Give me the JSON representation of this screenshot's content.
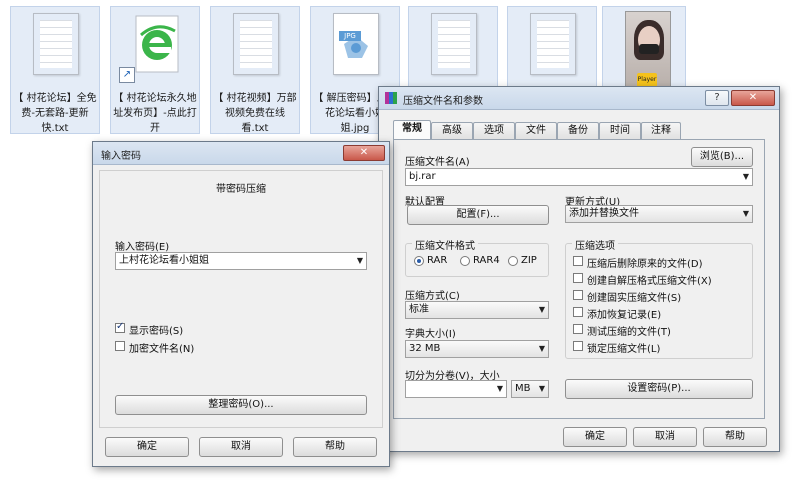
{
  "desktop": {
    "files": [
      {
        "caption": "【 村花论坛】全免费-无套路-更新快.txt"
      },
      {
        "caption": "【 村花论坛永久地址发布页】-点此打开"
      },
      {
        "caption": "【 村花视频】万部视频免费在线看.txt"
      },
      {
        "caption": "【 解压密码】上村花论坛看小姐姐.jpg",
        "badge": "JPG"
      },
      {
        "caption": ""
      },
      {
        "caption": ""
      },
      {
        "caption": "",
        "badge": "Player"
      }
    ]
  },
  "password_dialog": {
    "title": "输入密码",
    "close": "✕",
    "heading": "带密码压缩",
    "password_label": "输入密码(E)",
    "password_value": "上村花论坛看小姐姐",
    "show_password": "显示密码(S)",
    "encrypt_names": "加密文件名(N)",
    "organize_button": "整理密码(O)...",
    "ok": "确定",
    "cancel": "取消",
    "help": "帮助"
  },
  "archive_dialog": {
    "title": "压缩文件名和参数",
    "help_btn": "?",
    "close": "✕",
    "tabs": [
      "常规",
      "高级",
      "选项",
      "文件",
      "备份",
      "时间",
      "注释"
    ],
    "archive_name_label": "压缩文件名(A)",
    "archive_name_value": "bj.rar",
    "browse": "浏览(B)...",
    "default_profile_label": "默认配置",
    "profile_button": "配置(F)...",
    "update_mode_label": "更新方式(U)",
    "update_mode_value": "添加并替换文件",
    "format_group": "压缩文件格式",
    "formats": [
      "RAR",
      "RAR4",
      "ZIP"
    ],
    "method_label": "压缩方式(C)",
    "method_value": "标准",
    "dict_label": "字典大小(I)",
    "dict_value": "32 MB",
    "split_label": "切分为分卷(V)，大小",
    "split_unit": "MB",
    "options_group": "压缩选项",
    "options": [
      "压缩后删除原来的文件(D)",
      "创建自解压格式压缩文件(X)",
      "创建固实压缩文件(S)",
      "添加恢复记录(E)",
      "测试压缩的文件(T)",
      "锁定压缩文件(L)"
    ],
    "set_password": "设置密码(P)...",
    "ok": "确定",
    "cancel": "取消",
    "help": "帮助"
  }
}
